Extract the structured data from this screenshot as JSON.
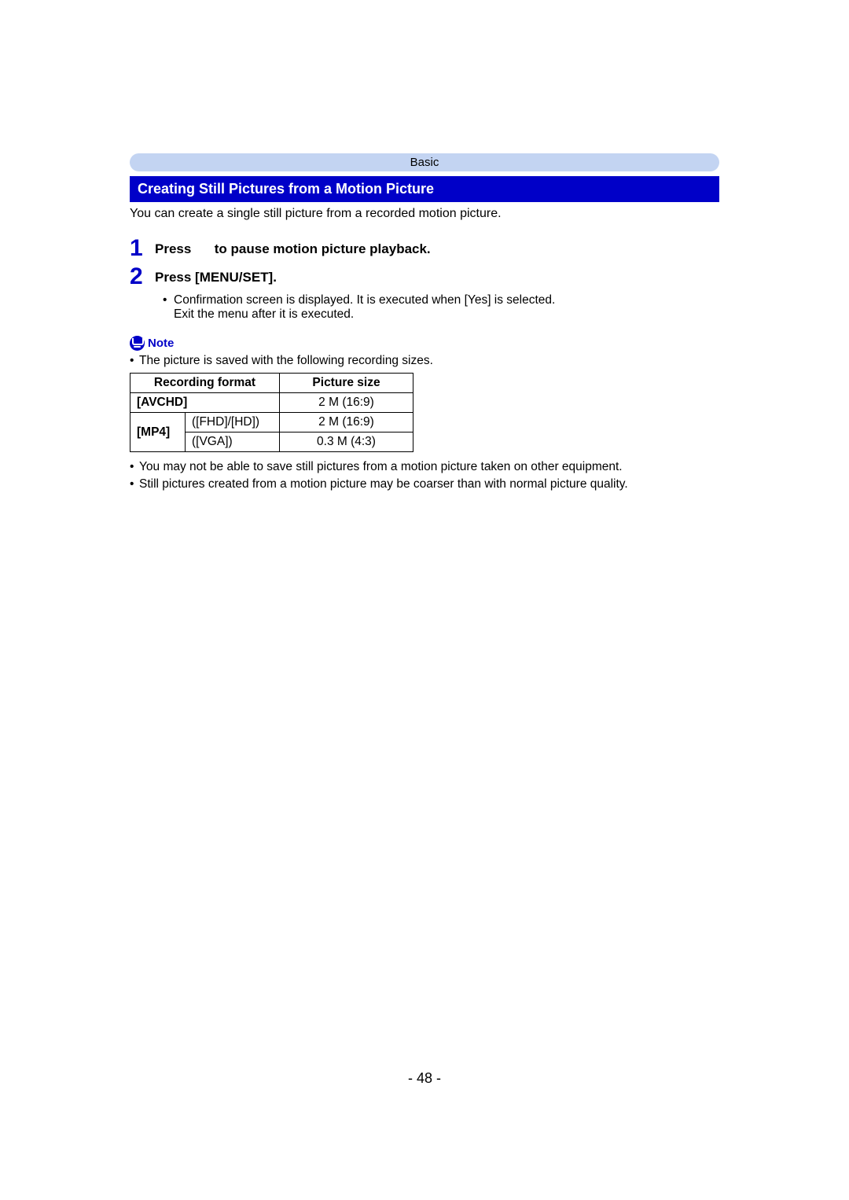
{
  "header": {
    "category": "Basic"
  },
  "section": {
    "title": "Creating Still Pictures from a Motion Picture"
  },
  "intro": "You can create a single still picture from a recorded motion picture.",
  "steps": [
    {
      "num": "1",
      "prefix": "Press ",
      "suffix": " to pause motion picture playback."
    },
    {
      "num": "2",
      "prefix": "Press [MENU/SET].",
      "suffix": ""
    }
  ],
  "step2_sub": {
    "line1": "Confirmation screen is displayed. It is executed when [Yes] is selected.",
    "line2": "Exit the menu after it is executed."
  },
  "note": {
    "label": "Note"
  },
  "note_lines": {
    "l1": "The picture is saved with the following recording sizes."
  },
  "table": {
    "headers": {
      "format": "Recording format",
      "size": "Picture size"
    },
    "rows": {
      "r1": {
        "format": "[AVCHD]",
        "size": "2 M (16:9)"
      },
      "r2_group": "[MP4]",
      "r2a": {
        "sub": "([FHD]/[HD])",
        "size": "2 M (16:9)"
      },
      "r2b": {
        "sub": "([VGA])",
        "size": "0.3 M (4:3)"
      }
    }
  },
  "after_table": {
    "b1": "You may not be able to save still pictures from a motion picture taken on other equipment.",
    "b2": "Still pictures created from a motion picture may be coarser than with normal picture quality."
  },
  "footer": {
    "page": "- 48 -"
  }
}
